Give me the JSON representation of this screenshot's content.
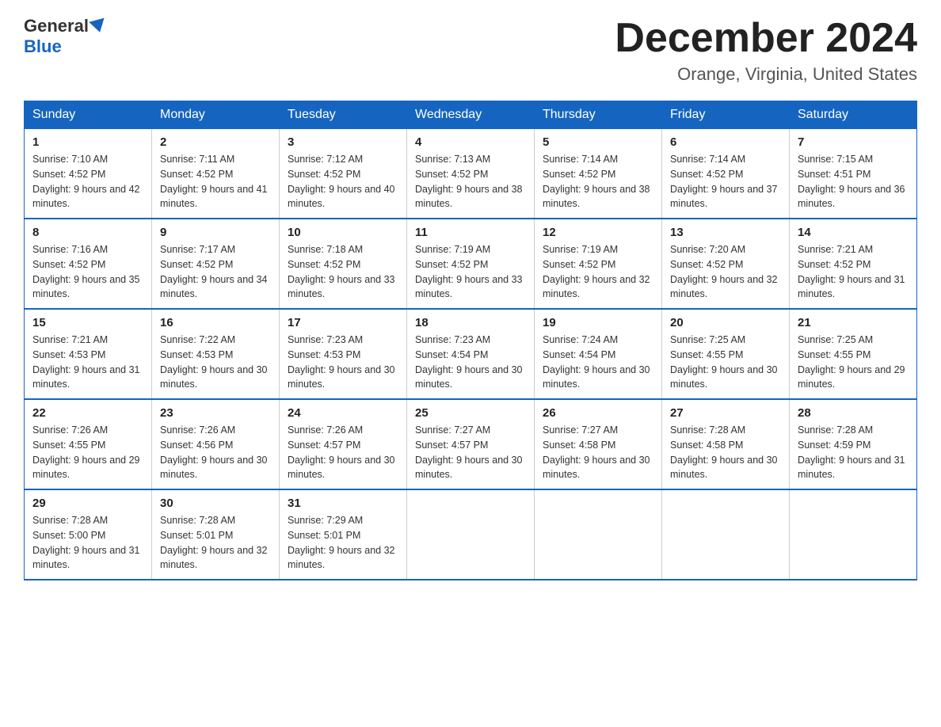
{
  "logo": {
    "general": "General",
    "blue": "Blue"
  },
  "title": "December 2024",
  "location": "Orange, Virginia, United States",
  "days_of_week": [
    "Sunday",
    "Monday",
    "Tuesday",
    "Wednesday",
    "Thursday",
    "Friday",
    "Saturday"
  ],
  "weeks": [
    [
      {
        "num": "1",
        "sunrise": "7:10 AM",
        "sunset": "4:52 PM",
        "daylight": "9 hours and 42 minutes."
      },
      {
        "num": "2",
        "sunrise": "7:11 AM",
        "sunset": "4:52 PM",
        "daylight": "9 hours and 41 minutes."
      },
      {
        "num": "3",
        "sunrise": "7:12 AM",
        "sunset": "4:52 PM",
        "daylight": "9 hours and 40 minutes."
      },
      {
        "num": "4",
        "sunrise": "7:13 AM",
        "sunset": "4:52 PM",
        "daylight": "9 hours and 38 minutes."
      },
      {
        "num": "5",
        "sunrise": "7:14 AM",
        "sunset": "4:52 PM",
        "daylight": "9 hours and 38 minutes."
      },
      {
        "num": "6",
        "sunrise": "7:14 AM",
        "sunset": "4:52 PM",
        "daylight": "9 hours and 37 minutes."
      },
      {
        "num": "7",
        "sunrise": "7:15 AM",
        "sunset": "4:51 PM",
        "daylight": "9 hours and 36 minutes."
      }
    ],
    [
      {
        "num": "8",
        "sunrise": "7:16 AM",
        "sunset": "4:52 PM",
        "daylight": "9 hours and 35 minutes."
      },
      {
        "num": "9",
        "sunrise": "7:17 AM",
        "sunset": "4:52 PM",
        "daylight": "9 hours and 34 minutes."
      },
      {
        "num": "10",
        "sunrise": "7:18 AM",
        "sunset": "4:52 PM",
        "daylight": "9 hours and 33 minutes."
      },
      {
        "num": "11",
        "sunrise": "7:19 AM",
        "sunset": "4:52 PM",
        "daylight": "9 hours and 33 minutes."
      },
      {
        "num": "12",
        "sunrise": "7:19 AM",
        "sunset": "4:52 PM",
        "daylight": "9 hours and 32 minutes."
      },
      {
        "num": "13",
        "sunrise": "7:20 AM",
        "sunset": "4:52 PM",
        "daylight": "9 hours and 32 minutes."
      },
      {
        "num": "14",
        "sunrise": "7:21 AM",
        "sunset": "4:52 PM",
        "daylight": "9 hours and 31 minutes."
      }
    ],
    [
      {
        "num": "15",
        "sunrise": "7:21 AM",
        "sunset": "4:53 PM",
        "daylight": "9 hours and 31 minutes."
      },
      {
        "num": "16",
        "sunrise": "7:22 AM",
        "sunset": "4:53 PM",
        "daylight": "9 hours and 30 minutes."
      },
      {
        "num": "17",
        "sunrise": "7:23 AM",
        "sunset": "4:53 PM",
        "daylight": "9 hours and 30 minutes."
      },
      {
        "num": "18",
        "sunrise": "7:23 AM",
        "sunset": "4:54 PM",
        "daylight": "9 hours and 30 minutes."
      },
      {
        "num": "19",
        "sunrise": "7:24 AM",
        "sunset": "4:54 PM",
        "daylight": "9 hours and 30 minutes."
      },
      {
        "num": "20",
        "sunrise": "7:25 AM",
        "sunset": "4:55 PM",
        "daylight": "9 hours and 30 minutes."
      },
      {
        "num": "21",
        "sunrise": "7:25 AM",
        "sunset": "4:55 PM",
        "daylight": "9 hours and 29 minutes."
      }
    ],
    [
      {
        "num": "22",
        "sunrise": "7:26 AM",
        "sunset": "4:55 PM",
        "daylight": "9 hours and 29 minutes."
      },
      {
        "num": "23",
        "sunrise": "7:26 AM",
        "sunset": "4:56 PM",
        "daylight": "9 hours and 30 minutes."
      },
      {
        "num": "24",
        "sunrise": "7:26 AM",
        "sunset": "4:57 PM",
        "daylight": "9 hours and 30 minutes."
      },
      {
        "num": "25",
        "sunrise": "7:27 AM",
        "sunset": "4:57 PM",
        "daylight": "9 hours and 30 minutes."
      },
      {
        "num": "26",
        "sunrise": "7:27 AM",
        "sunset": "4:58 PM",
        "daylight": "9 hours and 30 minutes."
      },
      {
        "num": "27",
        "sunrise": "7:28 AM",
        "sunset": "4:58 PM",
        "daylight": "9 hours and 30 minutes."
      },
      {
        "num": "28",
        "sunrise": "7:28 AM",
        "sunset": "4:59 PM",
        "daylight": "9 hours and 31 minutes."
      }
    ],
    [
      {
        "num": "29",
        "sunrise": "7:28 AM",
        "sunset": "5:00 PM",
        "daylight": "9 hours and 31 minutes."
      },
      {
        "num": "30",
        "sunrise": "7:28 AM",
        "sunset": "5:01 PM",
        "daylight": "9 hours and 32 minutes."
      },
      {
        "num": "31",
        "sunrise": "7:29 AM",
        "sunset": "5:01 PM",
        "daylight": "9 hours and 32 minutes."
      },
      {
        "num": "",
        "sunrise": "",
        "sunset": "",
        "daylight": ""
      },
      {
        "num": "",
        "sunrise": "",
        "sunset": "",
        "daylight": ""
      },
      {
        "num": "",
        "sunrise": "",
        "sunset": "",
        "daylight": ""
      },
      {
        "num": "",
        "sunrise": "",
        "sunset": "",
        "daylight": ""
      }
    ]
  ]
}
